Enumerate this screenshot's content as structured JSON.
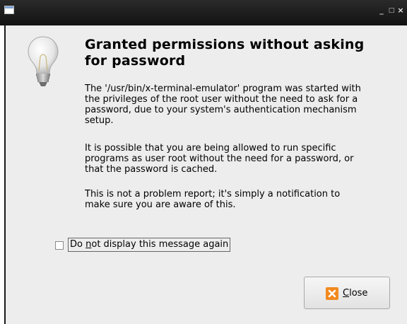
{
  "window": {
    "controls": {
      "minimize": "_",
      "maximize": "□",
      "close": "×"
    }
  },
  "dialog": {
    "icon": "lightbulb-icon",
    "heading_line1": "Granted permissions without asking",
    "heading_line2": "for password",
    "paragraph1": [
      "The '/usr/bin/x-terminal-emulator' program was started with",
      "the privileges of the root user without the need to ask for a",
      "password, due to your system's authentication mechanism",
      "setup."
    ],
    "paragraph2": [
      "It is possible that you are being allowed to run specific",
      "programs as user root without the need for a password, or",
      "that the password is cached."
    ],
    "paragraph3": [
      "This is not a problem report; it's simply a notification to",
      "make sure you are aware of this."
    ],
    "checkbox": {
      "checked": false,
      "label_pre": "Do ",
      "label_mnemonic": "n",
      "label_post": "ot display this message again"
    },
    "close_button": {
      "icon": "close-icon",
      "mnemonic": "C",
      "label_rest": "lose",
      "icon_color": "#f28a1e"
    }
  }
}
